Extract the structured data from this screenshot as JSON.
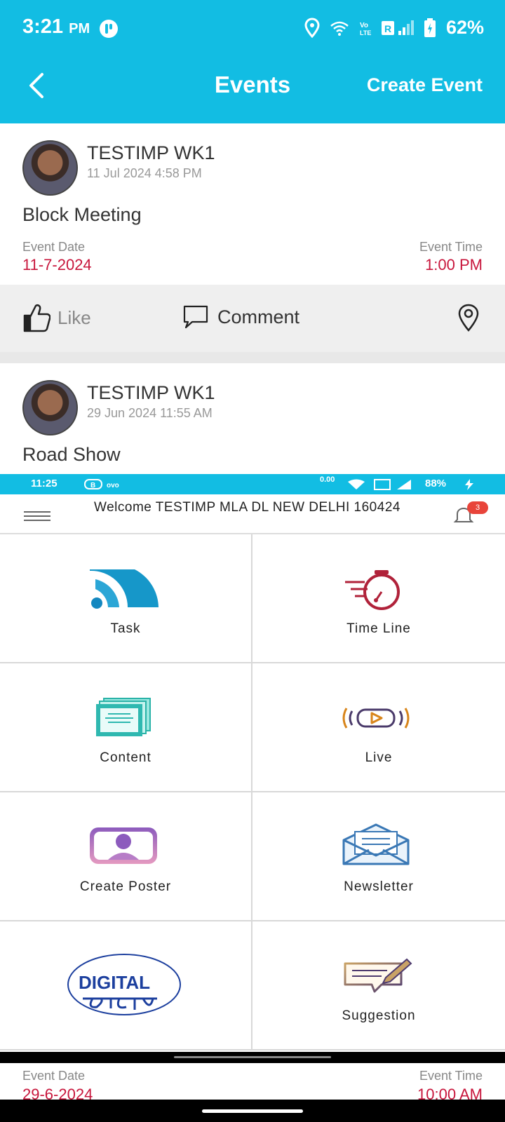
{
  "status_bar": {
    "time": "3:21",
    "ampm": "PM",
    "battery": "62%"
  },
  "app_bar": {
    "title": "Events",
    "create_label": "Create Event"
  },
  "events": [
    {
      "user": "TESTIMP WK1",
      "posted": "11 Jul 2024 4:58 PM",
      "title": "Block Meeting",
      "date_label": "Event Date",
      "date": "11-7-2024",
      "time_label": "Event Time",
      "time": "1:00 PM"
    },
    {
      "user": "TESTIMP WK1",
      "posted": "29 Jun 2024 11:55 AM",
      "title": "Road Show",
      "date_label": "Event Date",
      "date": "29-6-2024",
      "time_label": "Event Time",
      "time": "10:00 AM"
    }
  ],
  "actions": {
    "like": "Like",
    "comment": "Comment"
  },
  "embedded": {
    "status": {
      "time": "11:25",
      "speed": "0.00",
      "battery": "88%"
    },
    "welcome": "Welcome TESTIMP MLA DL NEW DELHI 160424",
    "notif_count": "3",
    "tiles": [
      {
        "label": "Task",
        "icon": "rss-icon"
      },
      {
        "label": "Time Line",
        "icon": "stopwatch-icon"
      },
      {
        "label": "Content",
        "icon": "document-stack-icon"
      },
      {
        "label": "Live",
        "icon": "live-broadcast-icon"
      },
      {
        "label": "Create Poster",
        "icon": "poster-profile-icon"
      },
      {
        "label": "Newsletter",
        "icon": "envelope-icon"
      },
      {
        "label": "",
        "icon": "digital-saathi-logo"
      },
      {
        "label": "Suggestion",
        "icon": "suggestion-icon"
      }
    ],
    "logo_text": "DIGITAL"
  },
  "colors": {
    "accent": "#12bde3",
    "date_red": "#c8163c"
  }
}
